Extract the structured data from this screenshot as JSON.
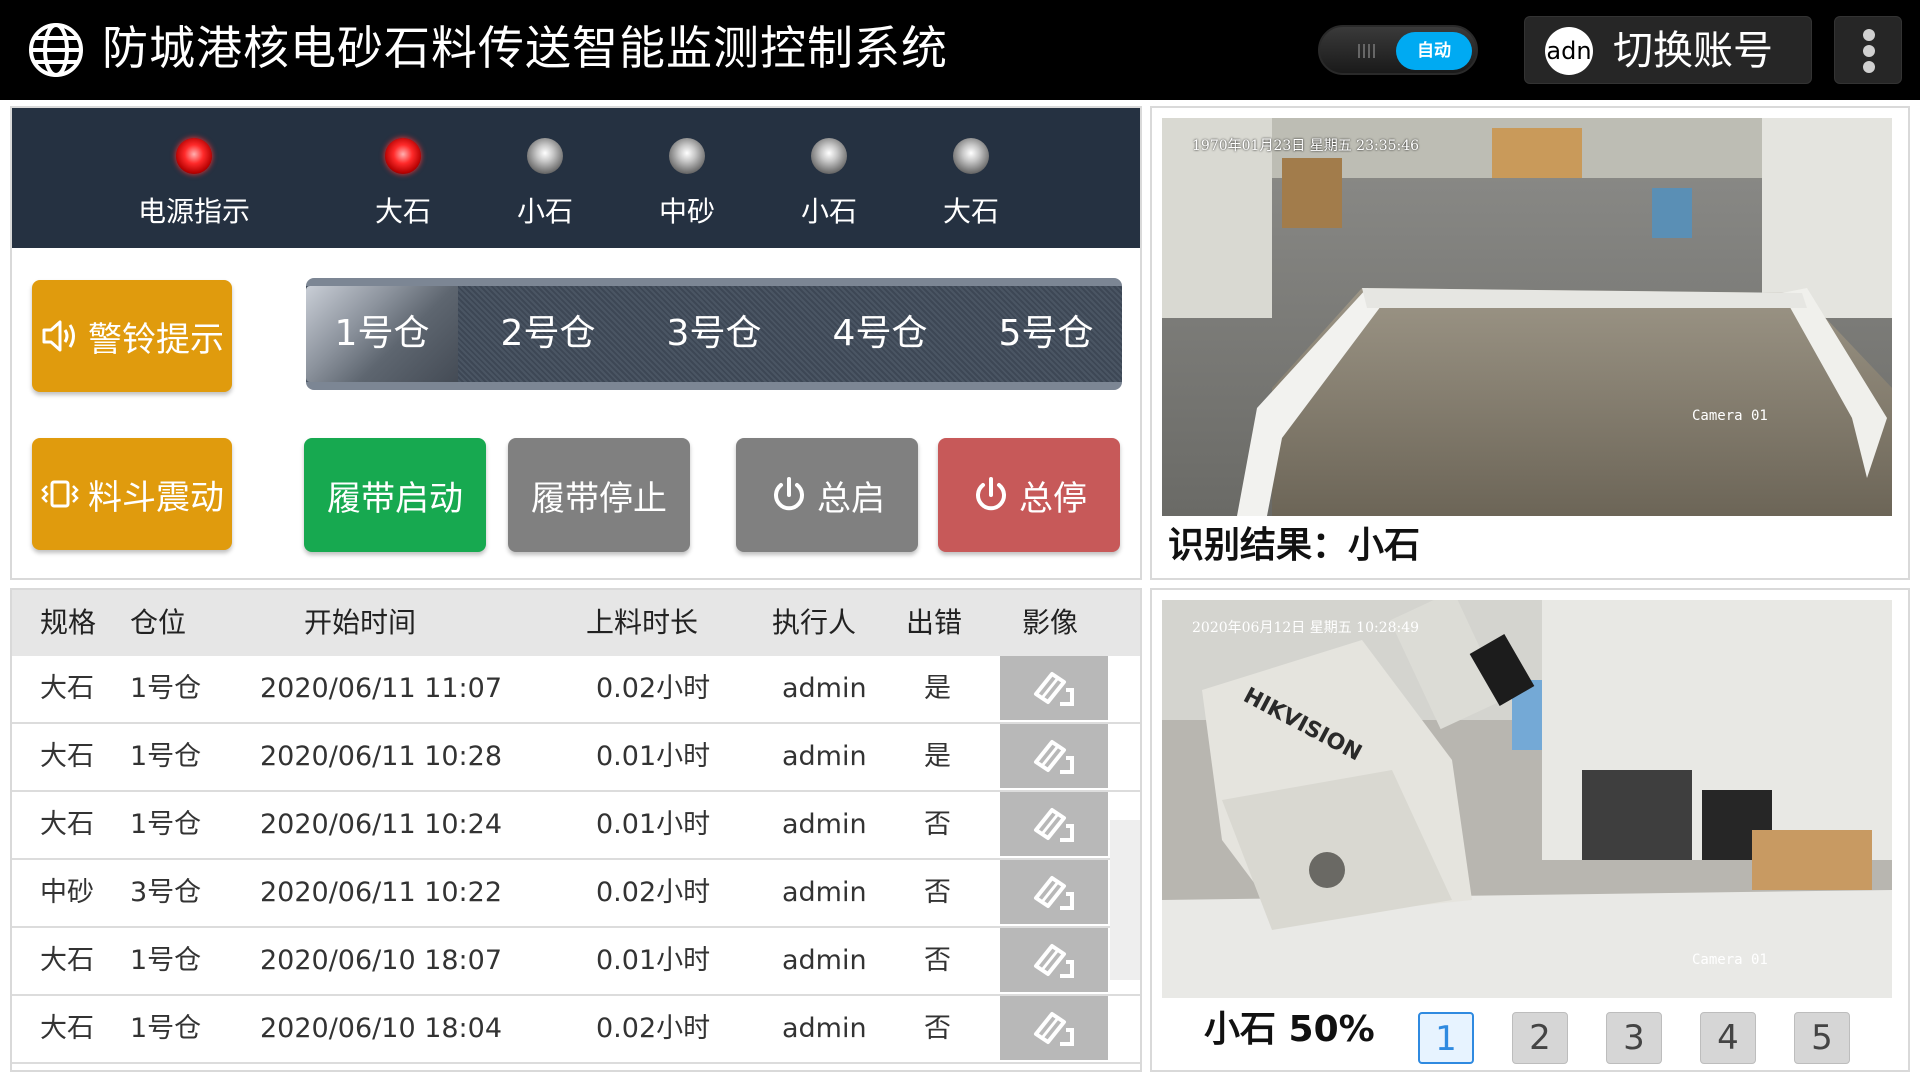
{
  "header": {
    "title": "防城港核电砂石料传送智能监测控制系统",
    "mode_toggle_label": "自动",
    "avatar_text": "adn",
    "switch_account_label": "切换账号"
  },
  "indicators": [
    {
      "label": "电源指示",
      "state": "on"
    },
    {
      "label": "大石",
      "state": "on"
    },
    {
      "label": "小石",
      "state": "off"
    },
    {
      "label": "中砂",
      "state": "off"
    },
    {
      "label": "小石",
      "state": "off"
    },
    {
      "label": "大石",
      "state": "off"
    }
  ],
  "controls": {
    "alarm_label": "警铃提示",
    "hopper_vibrate_label": "料斗震动",
    "belt_start_label": "履带启动",
    "belt_stop_label": "履带停止",
    "master_start_label": "总启",
    "master_stop_label": "总停"
  },
  "bins": {
    "tabs": [
      "1号仓",
      "2号仓",
      "3号仓",
      "4号仓",
      "5号仓"
    ],
    "selected": "1号仓"
  },
  "table": {
    "headers": [
      "规格",
      "仓位",
      "开始时间",
      "上料时长",
      "执行人",
      "出错",
      "影像"
    ],
    "rows": [
      [
        "大石",
        "1号仓",
        "2020/06/11 11:07",
        "0.02小时",
        "admin",
        "是"
      ],
      [
        "大石",
        "1号仓",
        "2020/06/11 10:28",
        "0.01小时",
        "admin",
        "是"
      ],
      [
        "大石",
        "1号仓",
        "2020/06/11 10:24",
        "0.01小时",
        "admin",
        "否"
      ],
      [
        "中砂",
        "3号仓",
        "2020/06/11 10:22",
        "0.02小时",
        "admin",
        "否"
      ],
      [
        "大石",
        "1号仓",
        "2020/06/10 18:07",
        "0.01小时",
        "admin",
        "否"
      ],
      [
        "大石",
        "1号仓",
        "2020/06/10 18:04",
        "0.02小时",
        "admin",
        "否"
      ]
    ]
  },
  "camera1": {
    "osd_time": "1970年01月23日 星期五 23:35:46",
    "osd_name": "Camera 01",
    "result_label": "识别结果：",
    "result_value": "小石"
  },
  "camera2": {
    "osd_time": "2020年06月12日 星期五 10:28:49",
    "osd_name": "Camera 01",
    "osd_brand": "HIKVISION",
    "status_text": "小石 50%",
    "buttons": [
      "1",
      "2",
      "3",
      "4",
      "5"
    ],
    "selected": "1"
  },
  "colors": {
    "header_bg": "#000000",
    "indicator_bar_bg": "#253141",
    "orange": "#e09b0d",
    "green": "#17a950",
    "gray": "#808080",
    "red": "#c75959",
    "toggle_on": "#00aaf2"
  },
  "icons": {
    "header": "globe-icon",
    "alarm": "speaker-icon",
    "vibrate": "vibrate-icon",
    "power": "power-icon",
    "image_row": "image-view-icon"
  }
}
